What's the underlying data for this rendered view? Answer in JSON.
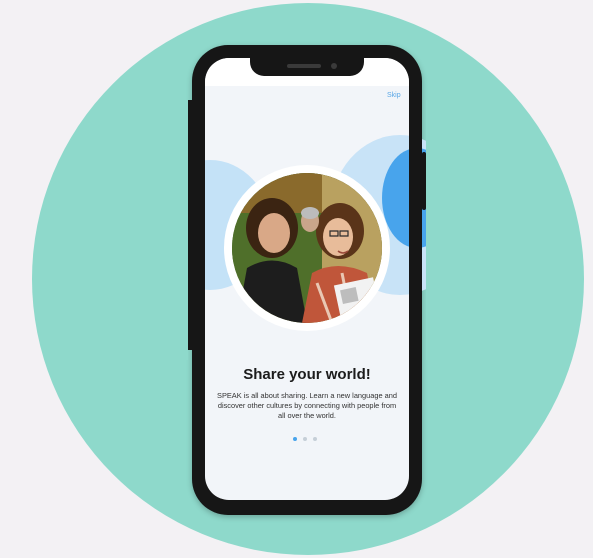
{
  "onboarding": {
    "skip_label": "Skip",
    "title": "Share your world!",
    "description": "SPEAK is all about sharing. Learn a new language and discover other cultures by connecting with people from all over the world.",
    "pagination": {
      "total": 3,
      "active_index": 0
    },
    "image": {
      "subject": "group-of-people-smiling-photo"
    }
  },
  "colors": {
    "background": "#f3f1f4",
    "circle": "#8ed9cb",
    "accent_blue": "#48a4ec",
    "light_blue": "#c4e2f7",
    "phone_frame": "#161616"
  },
  "icons": {
    "skip": "skip-link",
    "photo": "people-photo"
  }
}
